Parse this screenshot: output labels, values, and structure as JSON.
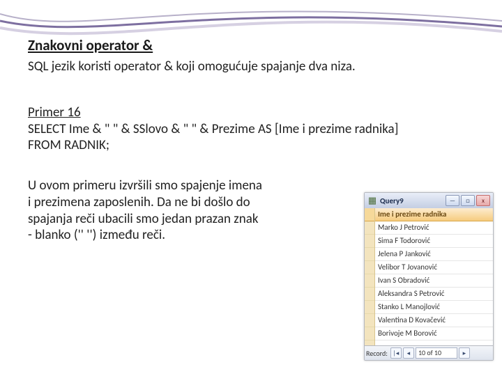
{
  "title": "Znakovni operator &",
  "intro": "SQL jezik koristi operator & koji omogućuje spajanje dva niza.",
  "example_label": "Primer 16",
  "sql_line1": "SELECT Ime & \" \" & SSlovo & \" \"  & Prezime AS [Ime i prezime radnika]",
  "sql_line2": "FROM RADNIK;",
  "explain1": "U ovom primeru izvršili smo spajenje imena",
  "explain2": " i prezimena zaposlenih. Da ne bi došlo do",
  "explain3": "spajanja reči ubacili smo jedan prazan znak",
  "explain4": "- blanko ('' '') između reči.",
  "query": {
    "title": "Query9",
    "header": "Ime i prezime radnika",
    "rows": [
      "Marko J Petrović",
      "Sima F Todorović",
      "Jelena P Janković",
      "Velibor T Jovanović",
      "Ivan S Obradović",
      "Aleksandra S Petrović",
      "Stanko L Manojlović",
      "Valentina D Kovačević",
      "Borivoje M Borović"
    ],
    "nav_label": "Record:",
    "nav_pos": "10 of 10",
    "first": "|◂",
    "prev": "◂",
    "next": "▸",
    "minimize": "—",
    "restore": "□",
    "close": "x"
  }
}
